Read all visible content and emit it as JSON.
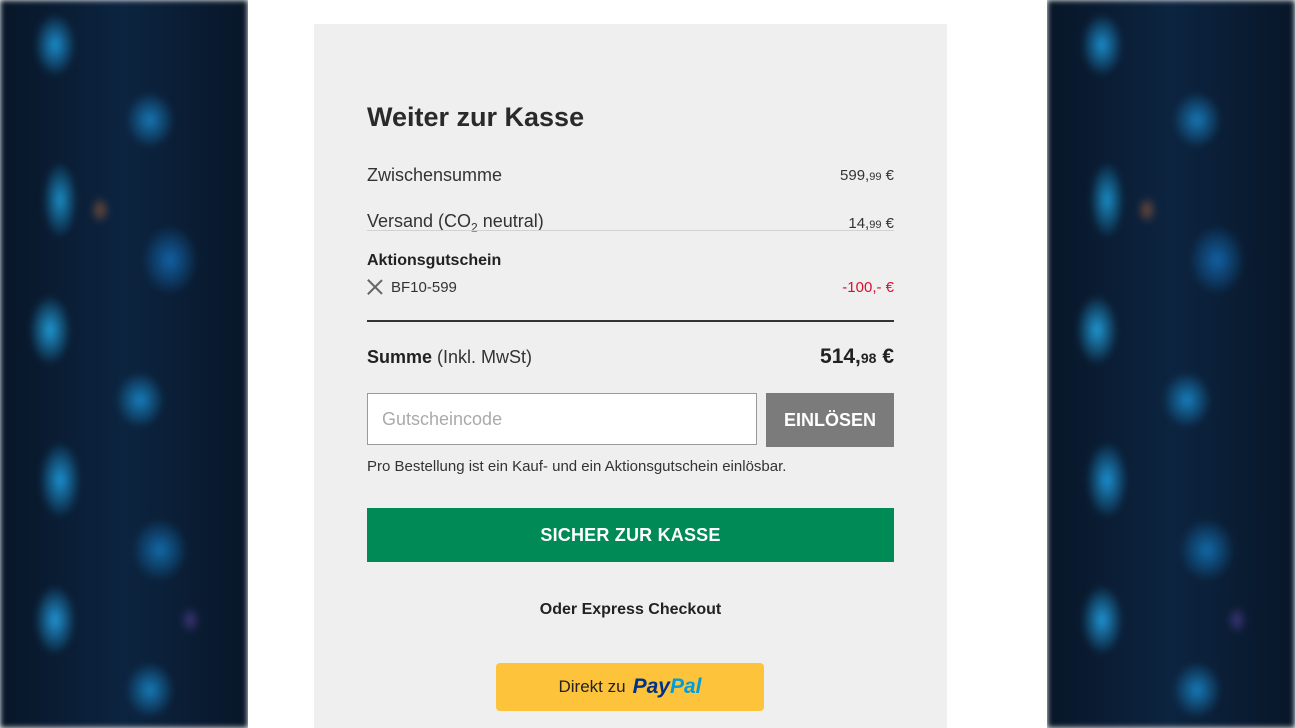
{
  "checkout": {
    "title": "Weiter zur Kasse",
    "subtotal": {
      "label": "Zwischensumme",
      "amount_main": "599,",
      "amount_cents": "99",
      "currency": "€"
    },
    "shipping": {
      "label_prefix": "Versand (CO",
      "label_sub": "2",
      "label_suffix": " neutral)",
      "amount_main": "14,",
      "amount_cents": "99",
      "currency": "€"
    },
    "voucher": {
      "title": "Aktionsgutschein",
      "code": "BF10-599",
      "amount": "-100,- €"
    },
    "total": {
      "label": "Summe",
      "label_note": "(Inkl. MwSt)",
      "amount_main": "514,",
      "amount_cents": "98",
      "currency": "€"
    },
    "coupon_input": {
      "placeholder": "Gutscheincode",
      "value": ""
    },
    "redeem_label": "EINLÖSEN",
    "note": "Pro Bestellung ist ein Kauf- und ein Aktionsgutschein einlösbar.",
    "checkout_label": "SICHER ZUR KASSE",
    "express_label": "Oder Express Checkout",
    "paypal": {
      "prefix": "Direkt zu",
      "logo_pay": "Pay",
      "logo_pal": "Pal"
    }
  },
  "colors": {
    "primary_green": "#008a55",
    "redeem_gray": "#7b7b7b",
    "discount_red": "#d9102f",
    "paypal_yellow": "#fdc33b",
    "paypal_dark_blue": "#003087",
    "paypal_light_blue": "#009cde",
    "panel_bg": "#efefef"
  },
  "icons": {
    "remove_voucher": "close-icon"
  }
}
